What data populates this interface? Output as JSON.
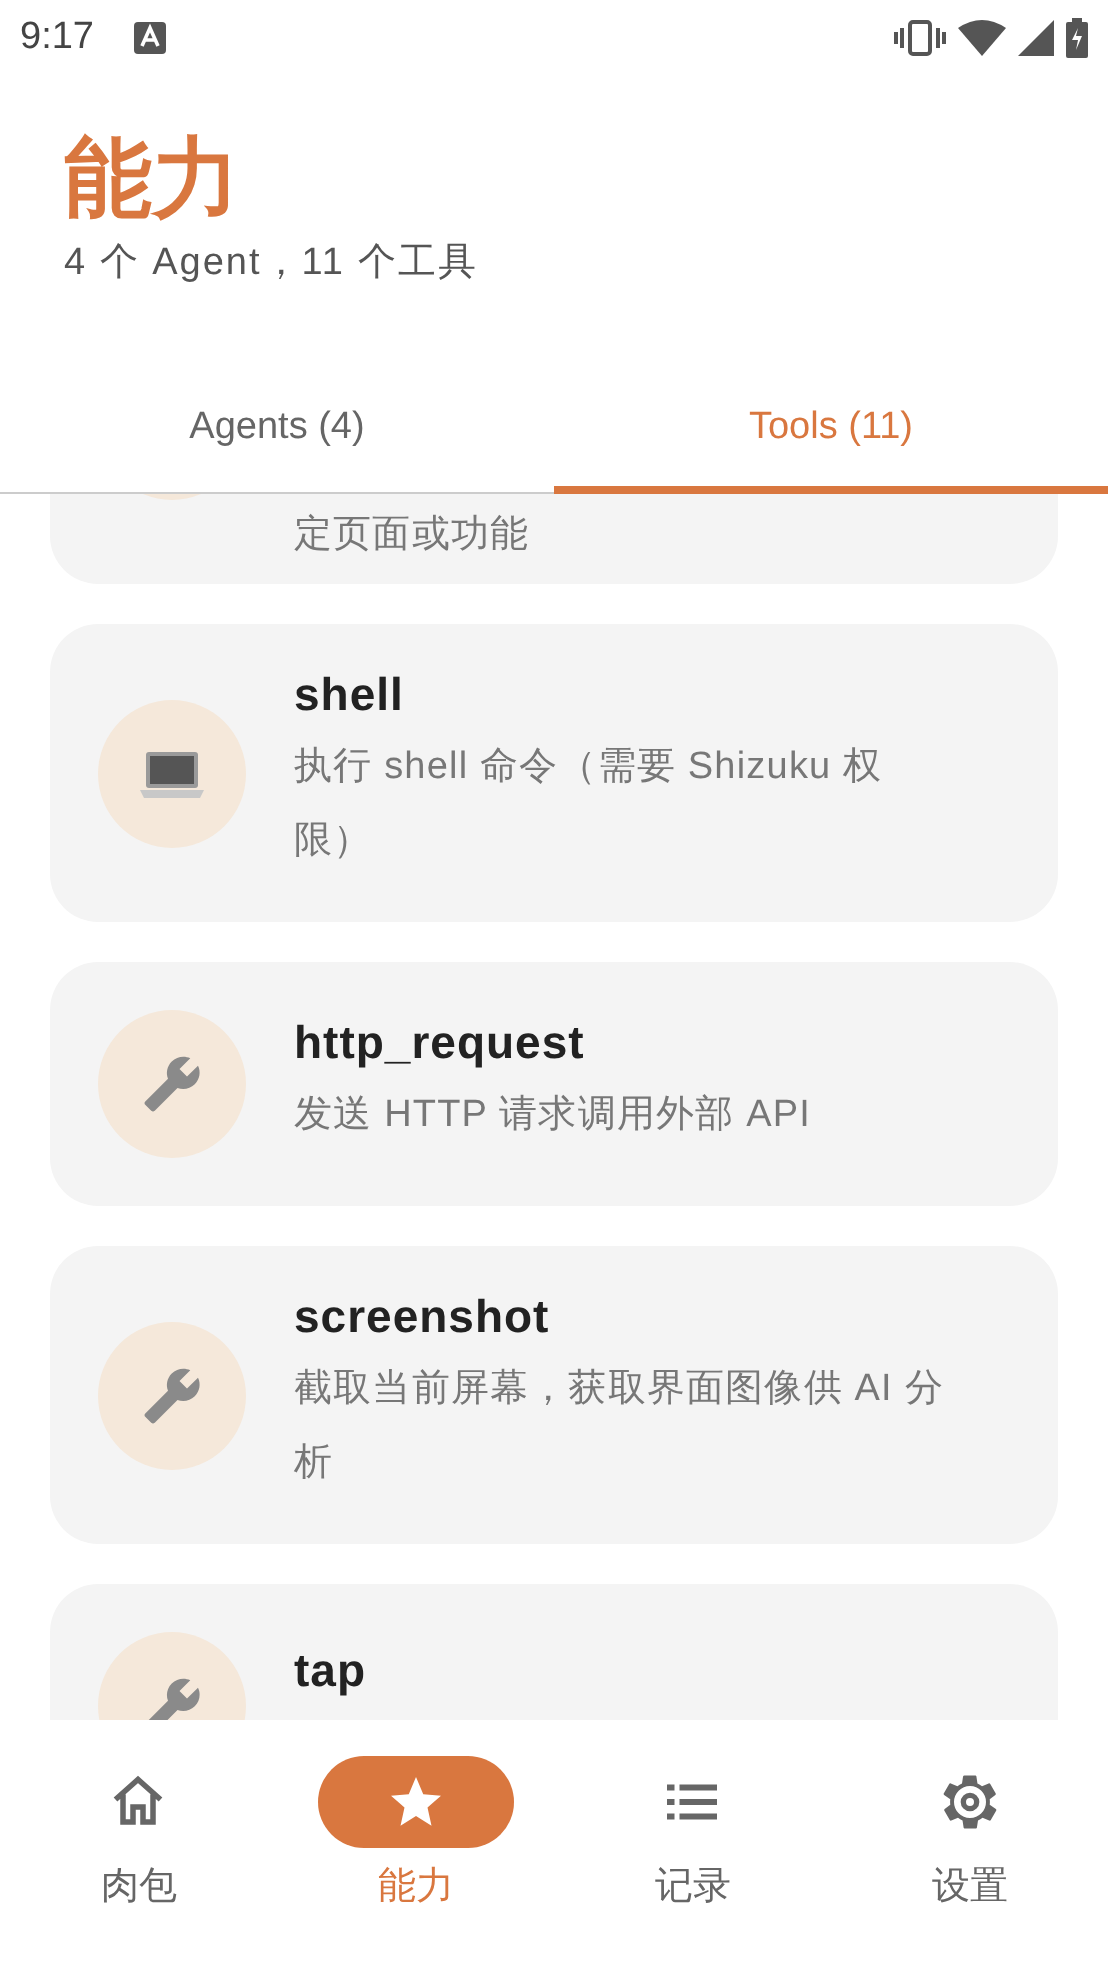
{
  "status_bar": {
    "time": "9:17"
  },
  "header": {
    "title": "能力",
    "subtitle": "4 个 Agent，11 个工具"
  },
  "tabs": [
    {
      "label": "Agents (4)",
      "selected": false
    },
    {
      "label": "Tools (11)",
      "selected": true
    }
  ],
  "tools": [
    {
      "partial": true,
      "description": "定页面或功能"
    },
    {
      "kind": "laptop",
      "name": "shell",
      "description": "执行 shell 命令（需要 Shizuku 权限）"
    },
    {
      "kind": "wrench",
      "name": "http_request",
      "description": "发送 HTTP 请求调用外部 API"
    },
    {
      "kind": "wrench",
      "name": "screenshot",
      "description": "截取当前屏幕，获取界面图像供 AI 分析"
    },
    {
      "kind": "wrench",
      "name": "tap"
    }
  ],
  "nav": [
    {
      "kind": "home",
      "label": "肉包",
      "selected": false
    },
    {
      "kind": "star",
      "label": "能力",
      "selected": true
    },
    {
      "kind": "list",
      "label": "记录",
      "selected": false
    },
    {
      "kind": "gear",
      "label": "设置",
      "selected": false
    }
  ]
}
